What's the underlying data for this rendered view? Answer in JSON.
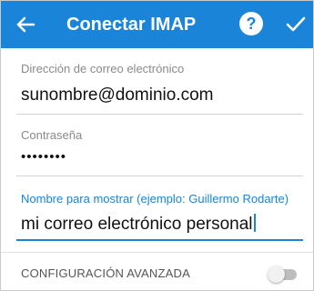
{
  "colors": {
    "appbar": "#1a84d8",
    "accent": "#1a84d8",
    "label": "#8a8a8a",
    "text": "#111111",
    "divider": "#d4d4d4"
  },
  "header": {
    "title": "Conectar IMAP",
    "back_icon": "arrow-left-icon",
    "help_icon": "help-circle-icon",
    "help_glyph": "?",
    "done_icon": "checkmark-icon"
  },
  "form": {
    "email": {
      "label": "Dirección de correo electrónico",
      "value": "sunombre@dominio.com"
    },
    "password": {
      "label": "Contraseña",
      "value": "••••••••"
    },
    "display_name": {
      "label": "Nombre para mostrar (ejemplo: Guillermo Rodarte)",
      "value": "mi correo electrónico personal"
    }
  },
  "advanced": {
    "label": "CONFIGURACIÓN AVANZADA",
    "enabled": false
  }
}
